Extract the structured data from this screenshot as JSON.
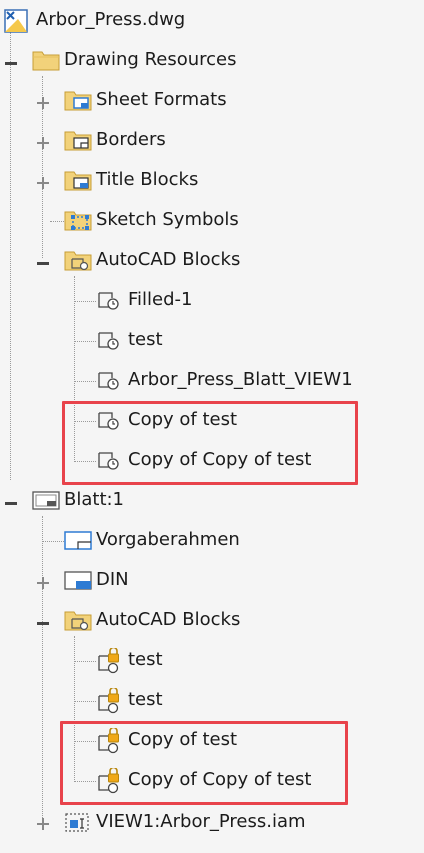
{
  "tree": {
    "root": {
      "label": "Arbor_Press.dwg",
      "icon": "drawing-file-icon"
    },
    "drawing_resources": {
      "label": "Drawing Resources",
      "icon": "folder-icon",
      "children": [
        {
          "label": "Sheet Formats",
          "icon": "sheet-format-folder-icon"
        },
        {
          "label": "Borders",
          "icon": "border-folder-icon"
        },
        {
          "label": "Title Blocks",
          "icon": "title-block-folder-icon"
        },
        {
          "label": "Sketch Symbols",
          "icon": "sketch-symbol-folder-icon"
        },
        {
          "label": "AutoCAD Blocks",
          "icon": "autocad-blocks-folder-icon",
          "children": [
            {
              "label": "Filled-1",
              "icon": "block-icon"
            },
            {
              "label": "test",
              "icon": "block-icon"
            },
            {
              "label": "Arbor_Press_Blatt_VIEW1",
              "icon": "block-icon"
            },
            {
              "label": "Copy of test",
              "icon": "block-icon"
            },
            {
              "label": "Copy of Copy of test",
              "icon": "block-icon"
            }
          ]
        }
      ]
    },
    "sheet": {
      "label": "Blatt:1",
      "icon": "sheet-icon",
      "children": [
        {
          "label": "Vorgaberahmen",
          "icon": "border-icon"
        },
        {
          "label": "DIN",
          "icon": "title-block-icon"
        },
        {
          "label": "AutoCAD Blocks",
          "icon": "autocad-blocks-folder-icon",
          "children": [
            {
              "label": "test",
              "icon": "locked-block-icon"
            },
            {
              "label": "test",
              "icon": "locked-block-icon"
            },
            {
              "label": "Copy of test",
              "icon": "locked-block-icon"
            },
            {
              "label": "Copy of Copy of test",
              "icon": "locked-block-icon"
            }
          ]
        },
        {
          "label": "VIEW1:Arbor_Press.iam",
          "icon": "view-icon"
        }
      ]
    }
  },
  "colors": {
    "highlight": "#e8434b",
    "folder": "#f2d27a",
    "accent_blue": "#2e7bd3"
  }
}
